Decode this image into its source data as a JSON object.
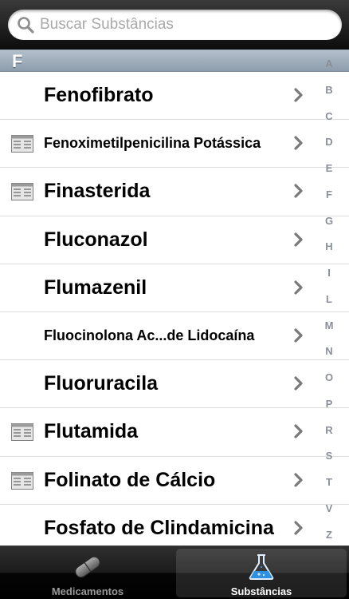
{
  "search": {
    "placeholder": "Buscar Substâncias",
    "value": ""
  },
  "section": {
    "letter": "F"
  },
  "rows": [
    {
      "label": "Fenofibrato",
      "has_doc_icon": false
    },
    {
      "label": "Fenoximetilpenicilina Potássica",
      "has_doc_icon": true
    },
    {
      "label": "Finasterida",
      "has_doc_icon": true
    },
    {
      "label": "Fluconazol",
      "has_doc_icon": false
    },
    {
      "label": "Flumazenil",
      "has_doc_icon": false
    },
    {
      "label": "Fluocinolona Ac...de Lidocaína",
      "has_doc_icon": false
    },
    {
      "label": "Fluoruracila",
      "has_doc_icon": false
    },
    {
      "label": "Flutamida",
      "has_doc_icon": true
    },
    {
      "label": "Folinato de Cálcio",
      "has_doc_icon": true
    },
    {
      "label": "Fosfato de Clindamicina",
      "has_doc_icon": false
    }
  ],
  "index_letters": [
    "A",
    "B",
    "C",
    "D",
    "E",
    "F",
    "G",
    "H",
    "I",
    "L",
    "M",
    "N",
    "O",
    "P",
    "R",
    "S",
    "T",
    "V",
    "Z"
  ],
  "tabs": [
    {
      "label": "Medicamentos",
      "icon": "pill-icon",
      "selected": false
    },
    {
      "label": "Substâncias",
      "icon": "flask-icon",
      "selected": true
    }
  ],
  "icons": {
    "search": "search-icon",
    "row_doc": "document-icon",
    "row_disclosure": "chevron-right-icon"
  },
  "colors": {
    "section_header": "#9aa8b8",
    "tab_bar": "#111111",
    "flask_blue": "#2f8fe0",
    "index_text": "#8a8f99"
  }
}
